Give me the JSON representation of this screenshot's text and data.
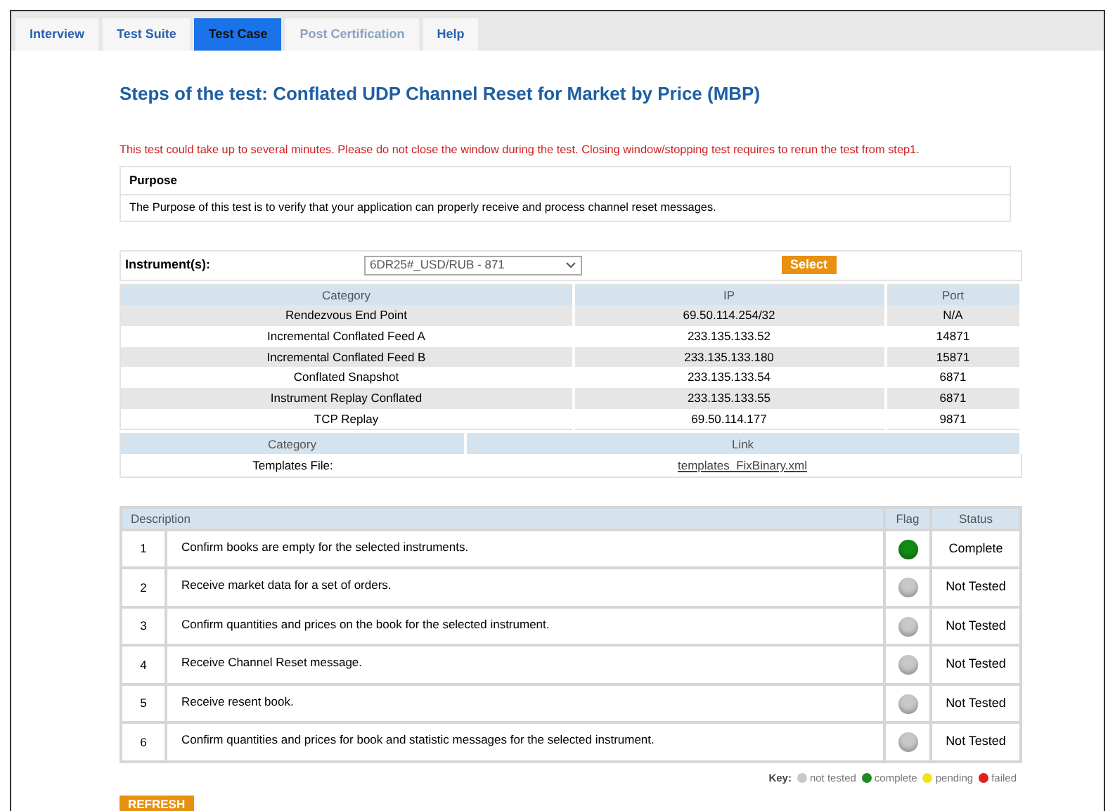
{
  "tabs": [
    {
      "label": "Interview",
      "selected": false,
      "disabled": false
    },
    {
      "label": "Test Suite",
      "selected": false,
      "disabled": false
    },
    {
      "label": "Test Case",
      "selected": true,
      "disabled": false
    },
    {
      "label": "Post Certification",
      "selected": false,
      "disabled": true
    },
    {
      "label": "Help",
      "selected": false,
      "disabled": false
    }
  ],
  "title": "Steps of the test: Conflated UDP Channel Reset for Market by Price (MBP)",
  "warning": "This test could take up to several minutes. Please do not close the window during the test. Closing window/stopping test requires to rerun the test from step1.",
  "purpose": {
    "heading": "Purpose",
    "text": "The Purpose of this test is to verify that your application can properly receive and process channel reset messages."
  },
  "instrument": {
    "label": "Instrument(s):",
    "value": "6DR25#_USD/RUB - 871",
    "button": "Select"
  },
  "network_table": {
    "columns": [
      "Category",
      "IP",
      "Port"
    ],
    "rows": [
      [
        "Rendezvous End Point",
        "69.50.114.254/32",
        "N/A"
      ],
      [
        "Incremental Conflated Feed A",
        "233.135.133.52",
        "14871"
      ],
      [
        "Incremental Conflated Feed B",
        "233.135.133.180",
        "15871"
      ],
      [
        "Conflated Snapshot",
        "233.135.133.54",
        "6871"
      ],
      [
        "Instrument Replay Conflated",
        "233.135.133.55",
        "6871"
      ],
      [
        "TCP Replay",
        "69.50.114.177",
        "9871"
      ]
    ]
  },
  "templates_table": {
    "columns": [
      "Category",
      "Link"
    ],
    "rows": [
      {
        "category": "Templates File:",
        "link": "templates_FixBinary.xml"
      }
    ]
  },
  "steps_table": {
    "columns": [
      "Description",
      "Flag",
      "Status"
    ],
    "rows": [
      {
        "number": "1",
        "description": "Confirm books are empty for the selected instruments.",
        "color": "#138a13",
        "status": "Complete"
      },
      {
        "number": "2",
        "description": "Receive market data for a set of orders.",
        "color": "#c8c8c8",
        "status": "Not Tested"
      },
      {
        "number": "3",
        "description": "Confirm quantities and prices on the book for the selected instrument.",
        "color": "#c8c8c8",
        "status": "Not Tested"
      },
      {
        "number": "4",
        "description": "Receive Channel Reset message.",
        "color": "#c8c8c8",
        "status": "Not Tested"
      },
      {
        "number": "5",
        "description": "Receive resent book.",
        "color": "#c8c8c8",
        "status": "Not Tested"
      },
      {
        "number": "6",
        "description": "Confirm quantities and prices for book and statistic messages for the selected instrument.",
        "color": "#c8c8c8",
        "status": "Not Tested"
      }
    ]
  },
  "key": {
    "label": "Key:",
    "items": [
      {
        "label": "not tested",
        "color": "#c8c8c8"
      },
      {
        "label": "complete",
        "color": "#1f8a1f"
      },
      {
        "label": "pending",
        "color": "#f2e21a"
      },
      {
        "label": "failed",
        "color": "#e02020"
      }
    ]
  },
  "refresh_button": "REFRESH"
}
